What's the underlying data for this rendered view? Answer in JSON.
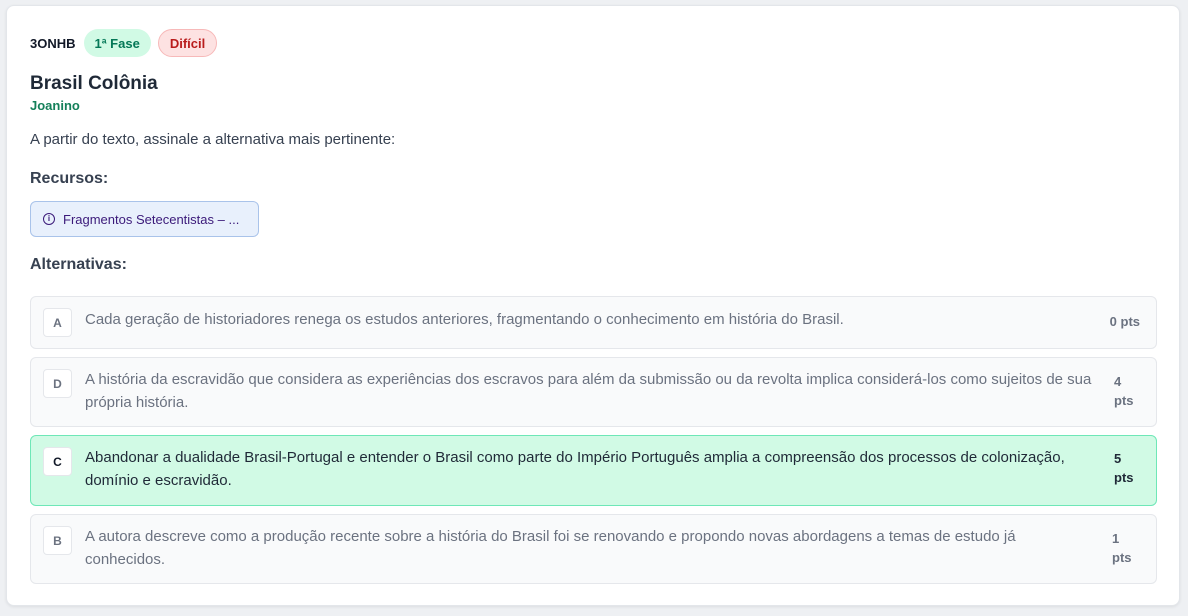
{
  "question": {
    "code": "3ONHB",
    "phase_badge": "1ª Fase",
    "difficulty_badge": "Difícil",
    "title": "Brasil Colônia",
    "author": "Joanino",
    "prompt": "A partir do texto, assinale a alternativa mais pertinente:"
  },
  "resources": {
    "label": "Recursos:",
    "items": [
      {
        "icon": "info-icon",
        "label": "Fragmentos Setecentistas – ..."
      }
    ]
  },
  "alternatives": {
    "label": "Alternativas:",
    "items": [
      {
        "letter": "A",
        "text": "Cada geração de historiadores renega os estudos anteriores, fragmentando o conhecimento em história do Brasil.",
        "points": "0 pts",
        "selected": false
      },
      {
        "letter": "D",
        "text": "A história da escravidão que considera as experiências dos escravos para além da submissão ou da revolta implica considerá-los como sujeitos de sua própria história.",
        "points_value": "4",
        "points_unit": "pts",
        "selected": false
      },
      {
        "letter": "C",
        "text": "Abandonar a dualidade Brasil-Portugal e entender o Brasil como parte do Império Português amplia a compreensão dos processos de colonização, domínio e escravidão.",
        "points_value": "5",
        "points_unit": "pts",
        "selected": true
      },
      {
        "letter": "B",
        "text": "A autora descreve como a produção recente sobre a história do Brasil foi se renovando e propondo novas abordagens a temas de estudo já conhecidos.",
        "points_value": "1",
        "points_unit": "pts",
        "selected": false
      }
    ]
  },
  "colors": {
    "accent_green": "#15805a",
    "selected_bg": "#d1fae5",
    "difficulty_red": "#b91c1c"
  }
}
